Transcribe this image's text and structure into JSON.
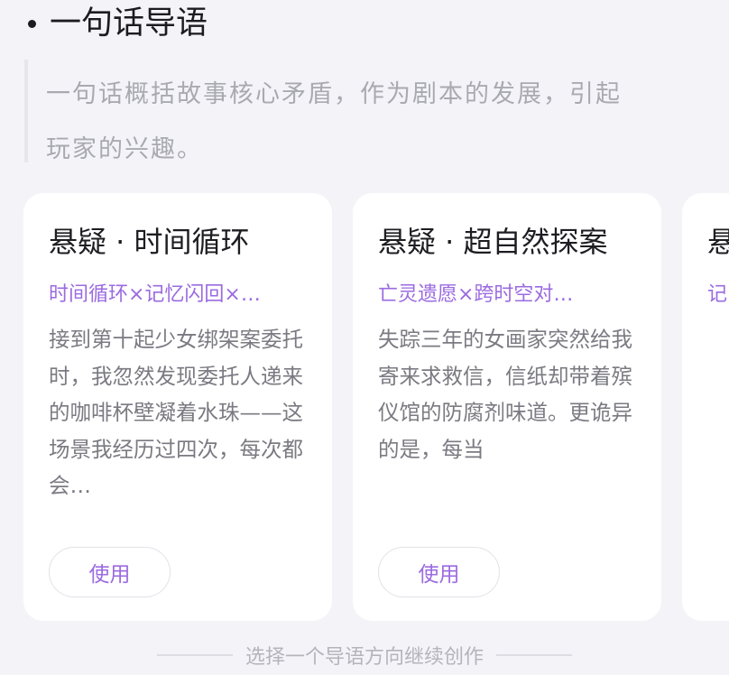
{
  "section": {
    "title": "一句话导语",
    "description_line1": "一句话概括故事核心矛盾，作为剧本的发展，引起",
    "description_line2": "玩家的兴趣。"
  },
  "cards": [
    {
      "title": "悬疑 · 时间循环",
      "tags": "时间循环×记忆闪回×…",
      "description": "接到第十起少女绑架案委托时，我忽然发现委托人递来的咖啡杯壁凝着水珠——这场景我经历过四次，每次都会…",
      "button_label": "使用"
    },
    {
      "title": "悬疑 · 超自然探案",
      "tags": "亡灵遗愿×跨时空对…",
      "description": "失踪三年的女画家突然给我寄来求救信，信纸却带着殡仪馆的防腐剂味道。更诡异的是，每当",
      "button_label": "使用"
    },
    {
      "title": "悬",
      "tags": "记",
      "description": "",
      "button_label": ""
    }
  ],
  "footer": {
    "hint": "选择一个导语方向继续创作"
  },
  "colors": {
    "accent": "#9b6be0",
    "background": "#f4f4f8",
    "card": "#ffffff",
    "muted_text": "#a9a9b1"
  }
}
